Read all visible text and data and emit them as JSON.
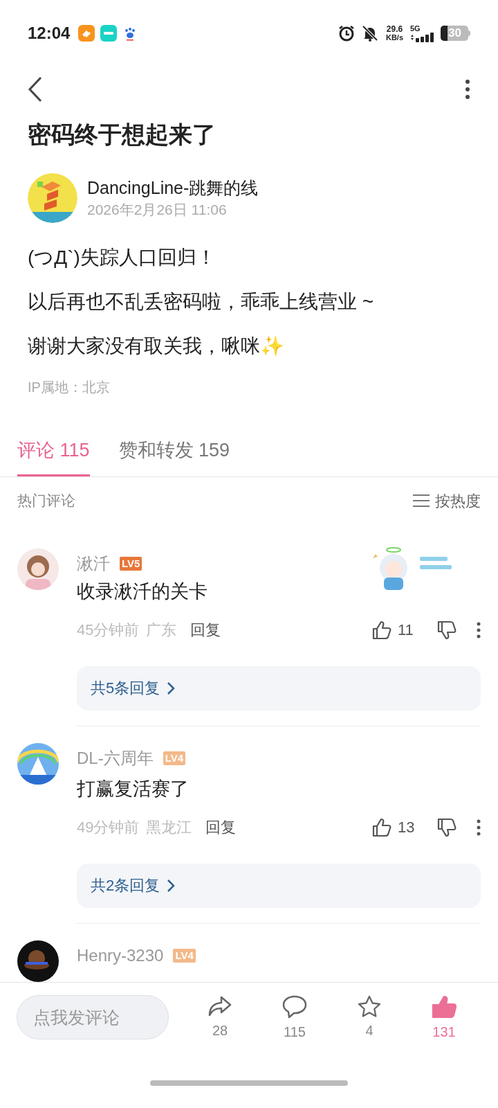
{
  "status_bar": {
    "time": "12:04",
    "speed_value": "29.6",
    "speed_unit": "KB/s",
    "network": "5G",
    "battery": "30"
  },
  "post": {
    "title": "密码终于想起来了",
    "author": "DancingLine-跳舞的线",
    "date": "2026年2月26日 11:06",
    "lines": [
      "(つД`)失踪人口回归！",
      "以后再也不乱丢密码啦，乖乖上线营业 ~",
      "谢谢大家没有取关我，啾咪✨"
    ],
    "ip": "IP属地：北京"
  },
  "tabs": [
    {
      "label": "评论 115",
      "selected": true
    },
    {
      "label": "赞和转发 159",
      "selected": false
    }
  ],
  "comments_header": {
    "title": "热门评论",
    "sort": "按热度"
  },
  "comments": [
    {
      "name": "湫汘",
      "level": "LV5",
      "color": "#e8773a",
      "sticker": true,
      "text": "收录湫汘的关卡",
      "time": "45分钟前",
      "location": "广东",
      "reply": "回复",
      "likes": "11",
      "replies": "共5条回复"
    },
    {
      "name": "DL-六周年",
      "level": "LV4",
      "color": "#f3b98a",
      "sticker": false,
      "text": "打赢复活赛了",
      "time": "49分钟前",
      "location": "黑龙江",
      "reply": "回复",
      "likes": "13",
      "replies": "共2条回复"
    },
    {
      "name": "Henry-3230",
      "level": "LV4",
      "color": "#f3b98a",
      "sticker": false
    }
  ],
  "bottom_bar": {
    "placeholder": "点我发评论",
    "actions": [
      {
        "kind": "share",
        "count": "28",
        "active": false
      },
      {
        "kind": "comment",
        "count": "115",
        "active": false
      },
      {
        "kind": "star",
        "count": "4",
        "active": false
      },
      {
        "kind": "like",
        "count": "131",
        "active": true
      }
    ]
  }
}
